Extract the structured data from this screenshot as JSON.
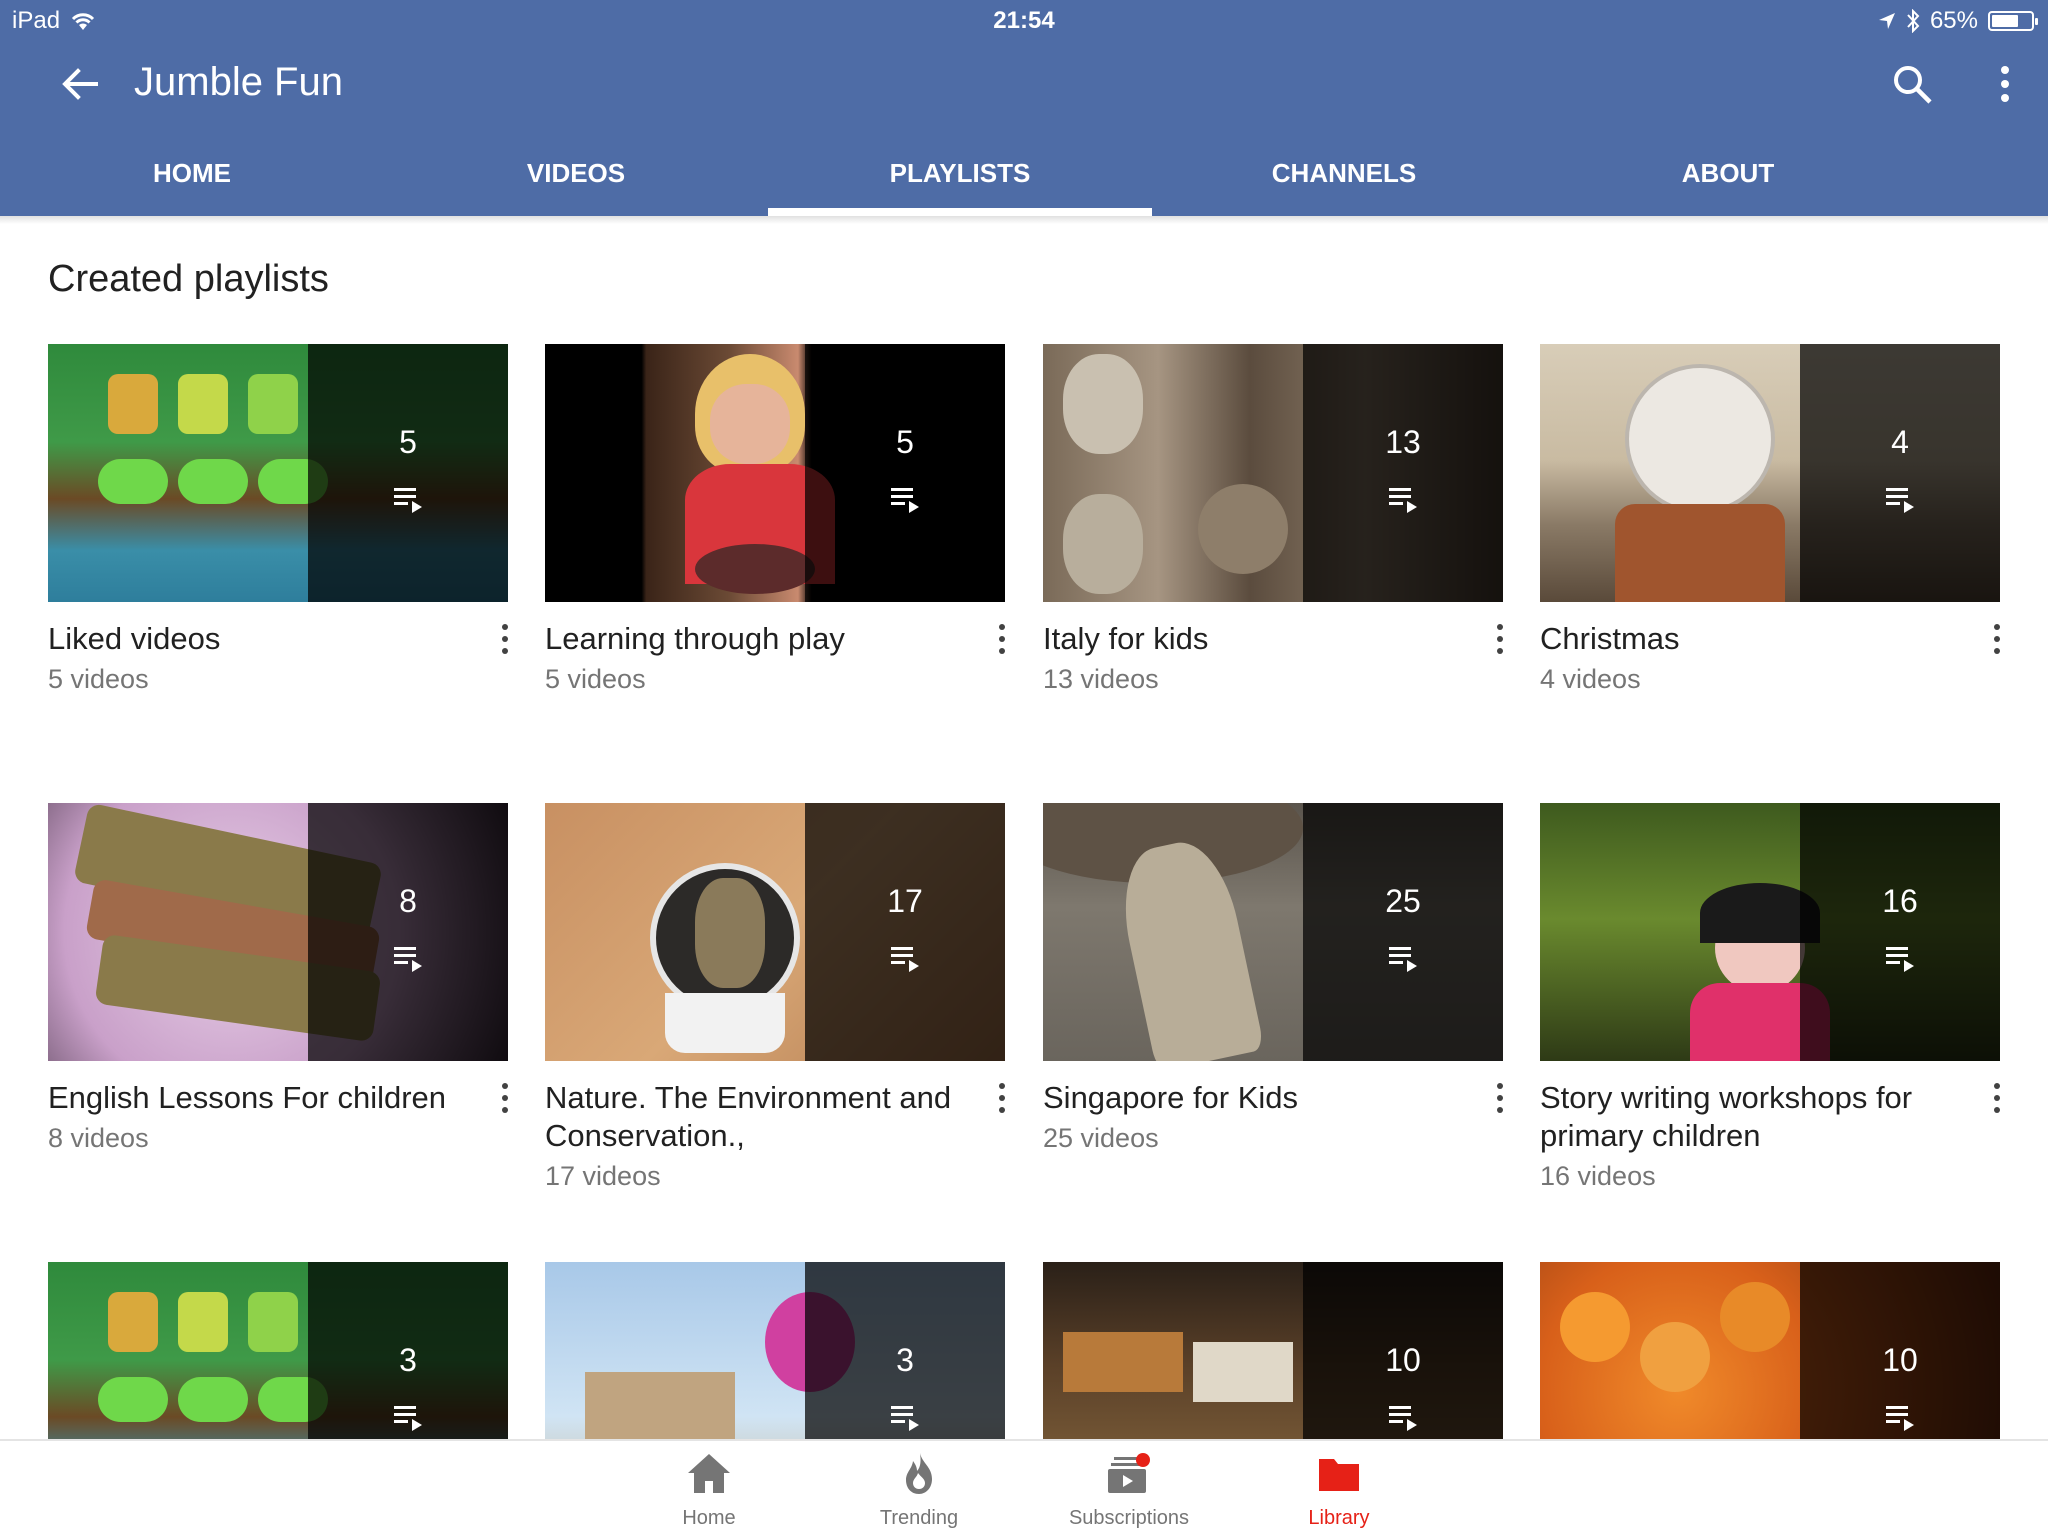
{
  "status_bar": {
    "device": "iPad",
    "time": "21:54",
    "battery": "65%"
  },
  "toolbar": {
    "title": "Jumble Fun"
  },
  "tabs": [
    {
      "label": "HOME",
      "active": false
    },
    {
      "label": "VIDEOS",
      "active": false
    },
    {
      "label": "PLAYLISTS",
      "active": true
    },
    {
      "label": "CHANNELS",
      "active": false
    },
    {
      "label": "ABOUT",
      "active": false
    }
  ],
  "section": {
    "title": "Created playlists"
  },
  "playlists": [
    {
      "title": "Liked videos",
      "count": "5",
      "subtitle": "5 videos"
    },
    {
      "title": "Learning through play",
      "count": "5",
      "subtitle": "5 videos"
    },
    {
      "title": "Italy for kids",
      "count": "13",
      "subtitle": "13 videos"
    },
    {
      "title": "Christmas",
      "count": "4",
      "subtitle": "4 videos"
    },
    {
      "title": "English Lessons For children",
      "count": "8",
      "subtitle": "8 videos"
    },
    {
      "title": "Nature. The  Environment and Conservation.,",
      "count": "17",
      "subtitle": "17 videos"
    },
    {
      "title": "Singapore for Kids",
      "count": "25",
      "subtitle": "25 videos"
    },
    {
      "title": "Story writing workshops for primary children",
      "count": "16",
      "subtitle": "16 videos"
    },
    {
      "title": "",
      "count": "3",
      "subtitle": ""
    },
    {
      "title": "",
      "count": "3",
      "subtitle": ""
    },
    {
      "title": "",
      "count": "10",
      "subtitle": ""
    },
    {
      "title": "",
      "count": "10",
      "subtitle": ""
    }
  ],
  "bottom_nav": [
    {
      "label": "Home",
      "icon": "home-icon",
      "active": false
    },
    {
      "label": "Trending",
      "icon": "trending-icon",
      "active": false
    },
    {
      "label": "Subscriptions",
      "icon": "subscriptions-icon",
      "active": false
    },
    {
      "label": "Library",
      "icon": "library-icon",
      "active": true
    }
  ],
  "colors": {
    "appbar": "#4e6ca6",
    "active_nav": "#e62117",
    "secondary_text": "#757575"
  }
}
